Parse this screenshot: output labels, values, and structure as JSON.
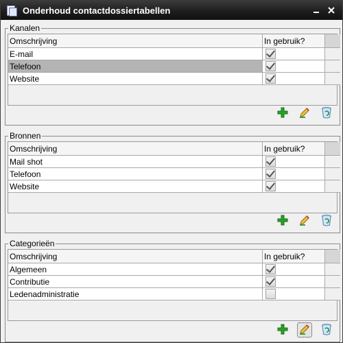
{
  "window": {
    "title": "Onderhoud contactdossiertabellen"
  },
  "columns": {
    "description": "Omschrijving",
    "in_use": "In gebruik?"
  },
  "groups": [
    {
      "title": "Kanalen",
      "rows": [
        {
          "label": "E-mail",
          "checked": true,
          "selected": false
        },
        {
          "label": "Telefoon",
          "checked": true,
          "selected": true
        },
        {
          "label": "Website",
          "checked": true,
          "selected": false
        }
      ]
    },
    {
      "title": "Bronnen",
      "rows": [
        {
          "label": "Mail shot",
          "checked": true,
          "selected": false
        },
        {
          "label": "Telefoon",
          "checked": true,
          "selected": false
        },
        {
          "label": "Website",
          "checked": true,
          "selected": false
        }
      ]
    },
    {
      "title": "Categorieën",
      "rows": [
        {
          "label": "Algemeen",
          "checked": true,
          "selected": false
        },
        {
          "label": "Contributie",
          "checked": true,
          "selected": false
        },
        {
          "label": "Ledenadministratie",
          "checked": false,
          "selected": false
        }
      ]
    }
  ],
  "icons": {
    "add": "plus-icon",
    "edit": "pencil-icon",
    "delete": "recycle-bin-icon"
  },
  "colors": {
    "titlebar": "#1c1c1c",
    "add_green": "#2aa02a",
    "selection": "#b4b4b4"
  }
}
